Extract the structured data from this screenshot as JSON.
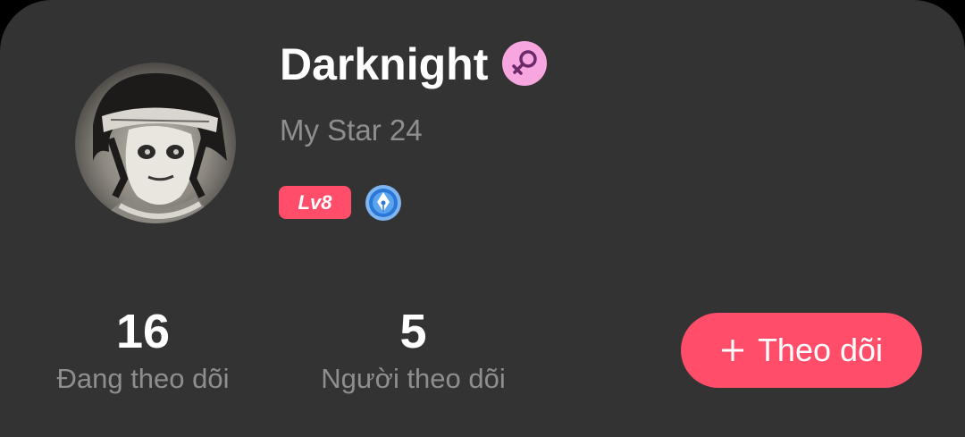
{
  "profile": {
    "name": "Darknight",
    "subtitle": "My Star 24",
    "level": "Lv8",
    "gender_icon": "female-symbol-icon",
    "badge_icon": "pen-nib-medal-icon",
    "avatar_icon": "anime-character-avatar"
  },
  "stats": {
    "following": {
      "value": "16",
      "label": "Đang theo dõi"
    },
    "followers": {
      "value": "5",
      "label": "Người theo dõi"
    }
  },
  "actions": {
    "follow_label": "Theo dõi",
    "follow_icon": "plus-icon"
  },
  "colors": {
    "background": "#333333",
    "accent": "#ff4d6a",
    "gender_badge": "#f7a6e0",
    "muted_text": "#8e8e8e"
  }
}
